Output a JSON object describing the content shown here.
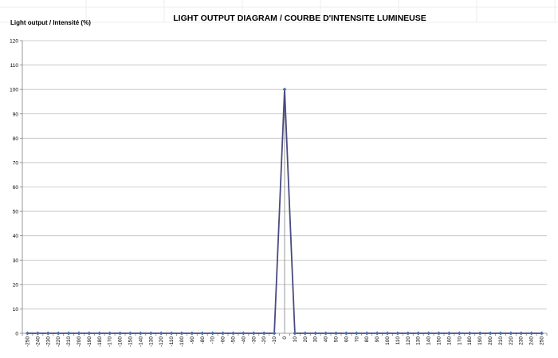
{
  "chart_data": {
    "type": "line",
    "title": "LIGHT OUTPUT DIAGRAM / COURBE D'INTENSITE LUMINEUSE",
    "ylabel": "Light output / Intensité (%)",
    "xlabel": "",
    "x": [
      -250,
      -240,
      -230,
      -220,
      -210,
      -200,
      -190,
      -180,
      -170,
      -160,
      -150,
      -140,
      -130,
      -120,
      -110,
      -100,
      -90,
      -80,
      -70,
      -60,
      -50,
      -40,
      -30,
      -20,
      -10,
      0,
      10,
      20,
      30,
      40,
      50,
      60,
      70,
      80,
      90,
      100,
      110,
      120,
      130,
      140,
      150,
      160,
      170,
      180,
      190,
      200,
      210,
      220,
      230,
      240,
      250
    ],
    "series": [
      {
        "values": [
          0,
          0,
          0,
          0,
          0,
          0,
          0,
          0,
          0,
          0,
          0,
          0,
          0,
          0,
          0,
          0,
          0,
          0,
          0,
          0,
          0,
          0,
          0,
          0,
          0,
          100,
          0,
          0,
          0,
          0,
          0,
          0,
          0,
          0,
          0,
          0,
          0,
          0,
          0,
          0,
          0,
          0,
          0,
          0,
          0,
          0,
          0,
          0,
          0,
          0,
          0
        ]
      }
    ],
    "ylim": [
      0,
      120
    ],
    "yticks": [
      0,
      10,
      20,
      30,
      40,
      50,
      60,
      70,
      80,
      90,
      100,
      110,
      120
    ],
    "grid": true,
    "legend": "none",
    "colors": {
      "line": "#4a4a82",
      "marker": "#4f6fa8",
      "grid": "#bfbfbf",
      "axis": "#808080"
    }
  }
}
